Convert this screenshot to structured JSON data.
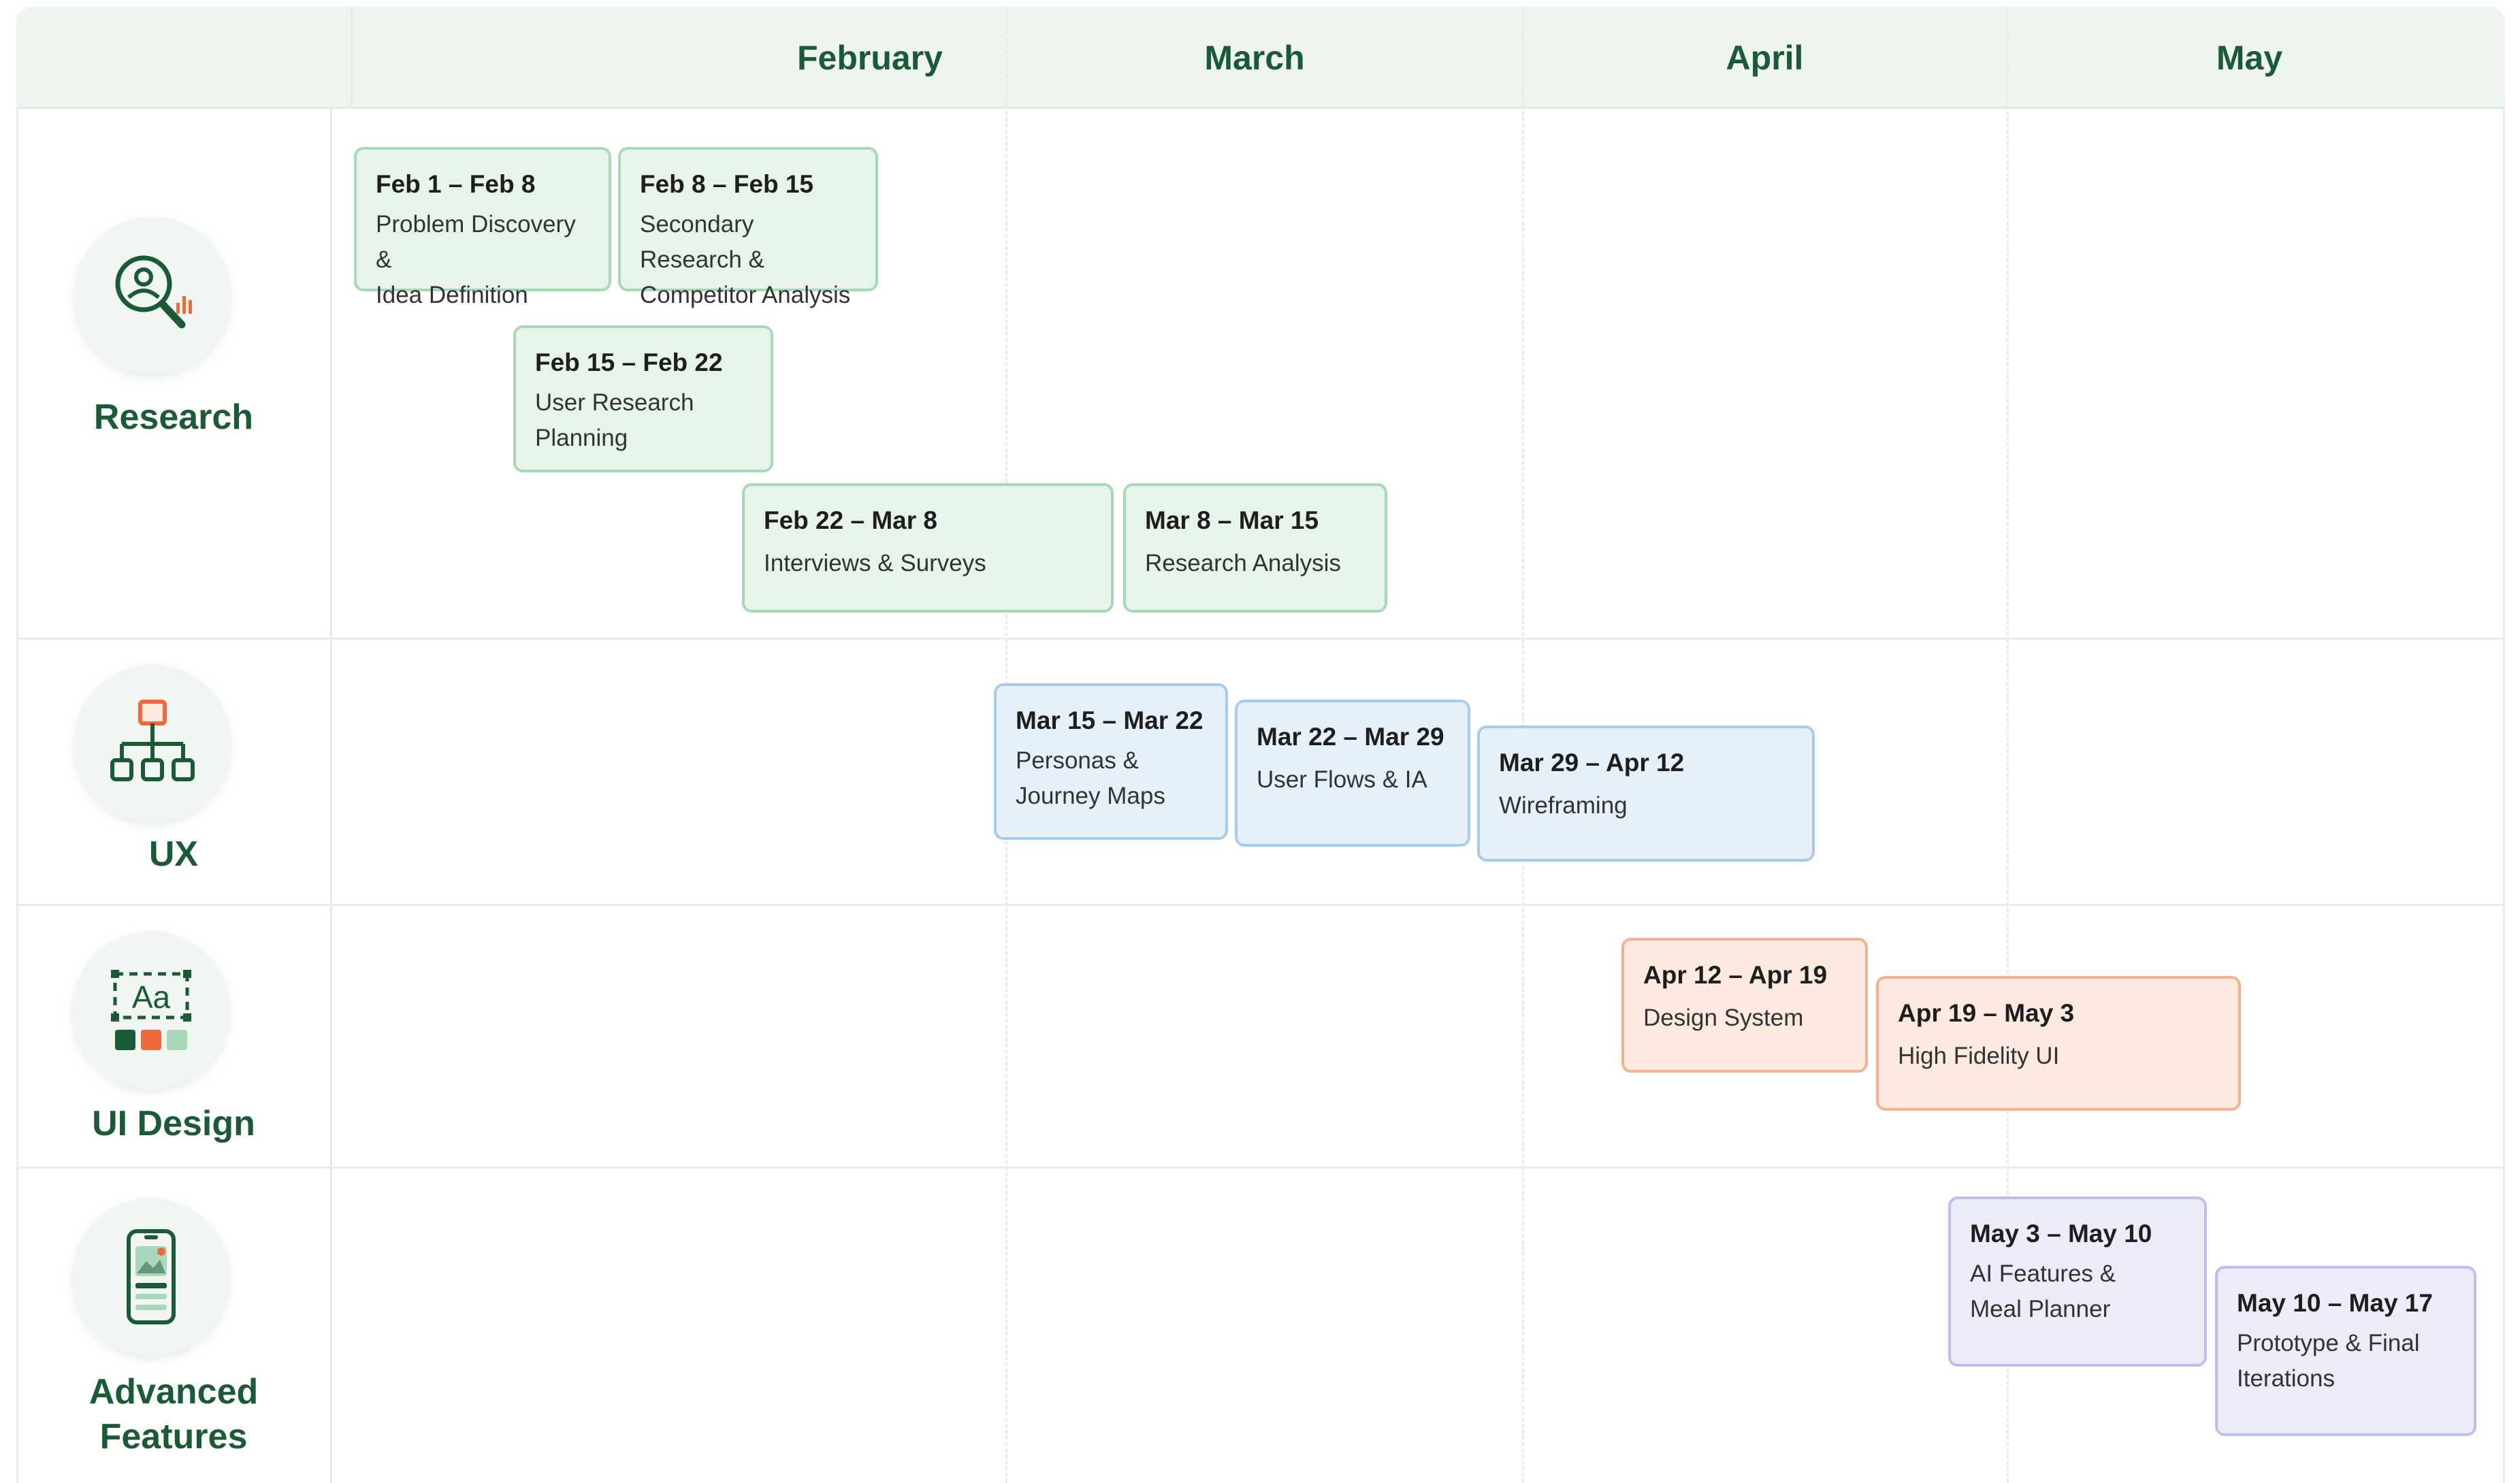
{
  "months": [
    "February",
    "March",
    "April",
    "May"
  ],
  "lanes": [
    {
      "label": "Research",
      "icon": "research-search-icon"
    },
    {
      "label": "UX",
      "icon": "sitemap-icon"
    },
    {
      "label": "UI Design",
      "icon": "typography-palette-icon"
    },
    {
      "label": "Advanced\nFeatures",
      "icon": "mobile-app-icon"
    }
  ],
  "tasks": [
    {
      "dates": "Feb 1 – Feb 8",
      "name": "Problem Discovery &\nIdea Definition",
      "lane": "Research",
      "color": "#e6f4ea"
    },
    {
      "dates": "Feb 8 – Feb 15",
      "name": "Secondary Research &\nCompetitor Analysis",
      "lane": "Research",
      "color": "#e6f4ea"
    },
    {
      "dates": "Feb 15 – Feb 22",
      "name": "User Research\nPlanning",
      "lane": "Research",
      "color": "#e6f4ea"
    },
    {
      "dates": "Feb 22 – Mar 8",
      "name": "Interviews & Surveys",
      "lane": "Research",
      "color": "#e6f4ea"
    },
    {
      "dates": "Mar 8 – Mar 15",
      "name": "Research Analysis",
      "lane": "Research",
      "color": "#e6f4ea"
    },
    {
      "dates": "Mar 15 – Mar 22",
      "name": "Personas &\nJourney Maps",
      "lane": "UX",
      "color": "#e6f0fb"
    },
    {
      "dates": "Mar 22 – Mar 29",
      "name": "User Flows & IA",
      "lane": "UX",
      "color": "#e6f0fb"
    },
    {
      "dates": "Mar 29 – Apr 12",
      "name": "Wireframing",
      "lane": "UX",
      "color": "#e6f0fb"
    },
    {
      "dates": "Apr 12 – Apr 19",
      "name": "Design System",
      "lane": "UI Design",
      "color": "#fdeadf"
    },
    {
      "dates": "Apr 19 – May 3",
      "name": "High Fidelity UI",
      "lane": "UI Design",
      "color": "#fdeadf"
    },
    {
      "dates": "May 3 – May 10",
      "name": "AI Features &\nMeal Planner",
      "lane": "Advanced Features",
      "color": "#ecebfa"
    },
    {
      "dates": "May 10 – May 17",
      "name": "Prototype & Final\nIterations",
      "lane": "Advanced Features",
      "color": "#ecebfa"
    }
  ],
  "colors": {
    "header_bg": "#eef5ef",
    "heading_text": "#1b5a37",
    "accent_orange": "#ee6a3c"
  }
}
